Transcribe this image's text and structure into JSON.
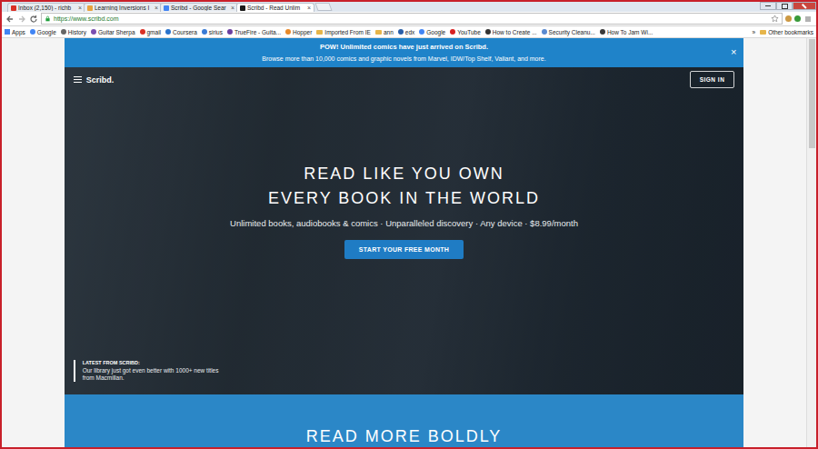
{
  "browser": {
    "tabs": [
      {
        "label": "Inbox (2,150) - richb",
        "selected": false,
        "color": "#d93025"
      },
      {
        "label": "Learning Inversions I",
        "selected": false,
        "color": "#e8a33d"
      },
      {
        "label": "Scribd - Google Sear",
        "selected": false,
        "color": "#4285f4"
      },
      {
        "label": "Scribd - Read Unlim",
        "selected": true,
        "color": "#1a1a1a"
      }
    ],
    "tab_close": "×",
    "url": "https://www.scribd.com",
    "bookmarks": [
      {
        "label": "Apps",
        "kind": "apps",
        "color": "#4285f4"
      },
      {
        "label": "Google",
        "kind": "site",
        "color": "#4285f4"
      },
      {
        "label": "History",
        "kind": "site",
        "color": "#666666"
      },
      {
        "label": "Guitar Sherpa",
        "kind": "site",
        "color": "#7a4fb0"
      },
      {
        "label": "gmail",
        "kind": "site",
        "color": "#d93025"
      },
      {
        "label": "Coursera",
        "kind": "site",
        "color": "#2a73cc"
      },
      {
        "label": "sirius",
        "kind": "site",
        "color": "#3a7bd5"
      },
      {
        "label": "TrueFire - Guita...",
        "kind": "site",
        "color": "#6a3fa0"
      },
      {
        "label": "Hopper",
        "kind": "site",
        "color": "#e88a2a"
      },
      {
        "label": "Imported From IE",
        "kind": "folder",
        "color": "#e6b54a"
      },
      {
        "label": "ann",
        "kind": "folder",
        "color": "#e6b54a"
      },
      {
        "label": "edx",
        "kind": "site",
        "color": "#2a5fa8"
      },
      {
        "label": "Google",
        "kind": "site",
        "color": "#4285f4"
      },
      {
        "label": "YouTube",
        "kind": "site",
        "color": "#d92020"
      },
      {
        "label": "How to Create ...",
        "kind": "site",
        "color": "#333333"
      },
      {
        "label": "Security Cleanu...",
        "kind": "site",
        "color": "#5a8ad0"
      },
      {
        "label": "How To Jam Wi...",
        "kind": "site",
        "color": "#3a3a3a"
      }
    ],
    "overflow": "»",
    "other_bookmarks": "Other bookmarks"
  },
  "page": {
    "banner": {
      "title": "POW! Unlimited comics have just arrived on Scribd.",
      "text": "Browse more than 10,000 comics and graphic novels from Marvel, IDW/Top Shelf, Valiant, and more.",
      "close": "×"
    },
    "nav": {
      "logo": "Scribd.",
      "sign_in": "SIGN IN"
    },
    "hero": {
      "title_lines": [
        "READ LIKE YOU OWN",
        "EVERY BOOK IN THE WORLD"
      ],
      "subtitle": "Unlimited books, audiobooks & comics · Unparalleled discovery · Any device · $8.99/month",
      "cta": "START YOUR FREE MONTH"
    },
    "latest": {
      "label": "LATEST FROM SCRIBD:",
      "text": "Our library just got even better with 1000+ new titles from Macmillan."
    },
    "section": {
      "title": "READ MORE BOLDLY"
    }
  }
}
